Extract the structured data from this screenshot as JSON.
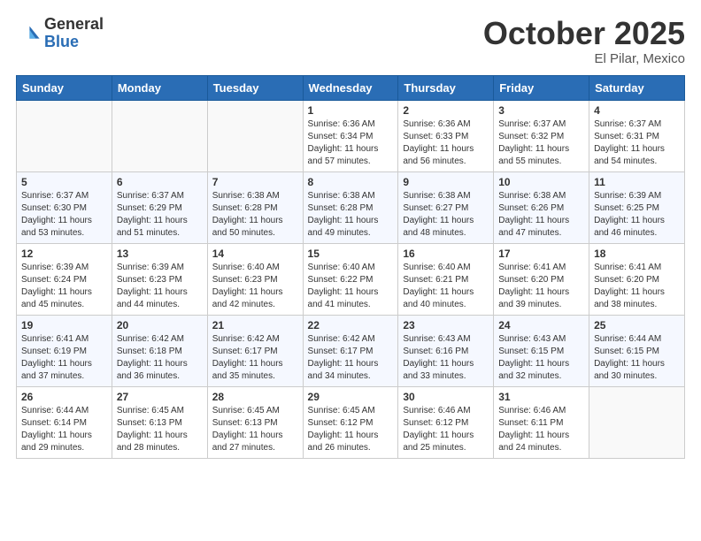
{
  "header": {
    "logo_general": "General",
    "logo_blue": "Blue",
    "month": "October 2025",
    "location": "El Pilar, Mexico"
  },
  "days_of_week": [
    "Sunday",
    "Monday",
    "Tuesday",
    "Wednesday",
    "Thursday",
    "Friday",
    "Saturday"
  ],
  "weeks": [
    [
      {
        "day": "",
        "info": ""
      },
      {
        "day": "",
        "info": ""
      },
      {
        "day": "",
        "info": ""
      },
      {
        "day": "1",
        "info": "Sunrise: 6:36 AM\nSunset: 6:34 PM\nDaylight: 11 hours\nand 57 minutes."
      },
      {
        "day": "2",
        "info": "Sunrise: 6:36 AM\nSunset: 6:33 PM\nDaylight: 11 hours\nand 56 minutes."
      },
      {
        "day": "3",
        "info": "Sunrise: 6:37 AM\nSunset: 6:32 PM\nDaylight: 11 hours\nand 55 minutes."
      },
      {
        "day": "4",
        "info": "Sunrise: 6:37 AM\nSunset: 6:31 PM\nDaylight: 11 hours\nand 54 minutes."
      }
    ],
    [
      {
        "day": "5",
        "info": "Sunrise: 6:37 AM\nSunset: 6:30 PM\nDaylight: 11 hours\nand 53 minutes."
      },
      {
        "day": "6",
        "info": "Sunrise: 6:37 AM\nSunset: 6:29 PM\nDaylight: 11 hours\nand 51 minutes."
      },
      {
        "day": "7",
        "info": "Sunrise: 6:38 AM\nSunset: 6:28 PM\nDaylight: 11 hours\nand 50 minutes."
      },
      {
        "day": "8",
        "info": "Sunrise: 6:38 AM\nSunset: 6:28 PM\nDaylight: 11 hours\nand 49 minutes."
      },
      {
        "day": "9",
        "info": "Sunrise: 6:38 AM\nSunset: 6:27 PM\nDaylight: 11 hours\nand 48 minutes."
      },
      {
        "day": "10",
        "info": "Sunrise: 6:38 AM\nSunset: 6:26 PM\nDaylight: 11 hours\nand 47 minutes."
      },
      {
        "day": "11",
        "info": "Sunrise: 6:39 AM\nSunset: 6:25 PM\nDaylight: 11 hours\nand 46 minutes."
      }
    ],
    [
      {
        "day": "12",
        "info": "Sunrise: 6:39 AM\nSunset: 6:24 PM\nDaylight: 11 hours\nand 45 minutes."
      },
      {
        "day": "13",
        "info": "Sunrise: 6:39 AM\nSunset: 6:23 PM\nDaylight: 11 hours\nand 44 minutes."
      },
      {
        "day": "14",
        "info": "Sunrise: 6:40 AM\nSunset: 6:23 PM\nDaylight: 11 hours\nand 42 minutes."
      },
      {
        "day": "15",
        "info": "Sunrise: 6:40 AM\nSunset: 6:22 PM\nDaylight: 11 hours\nand 41 minutes."
      },
      {
        "day": "16",
        "info": "Sunrise: 6:40 AM\nSunset: 6:21 PM\nDaylight: 11 hours\nand 40 minutes."
      },
      {
        "day": "17",
        "info": "Sunrise: 6:41 AM\nSunset: 6:20 PM\nDaylight: 11 hours\nand 39 minutes."
      },
      {
        "day": "18",
        "info": "Sunrise: 6:41 AM\nSunset: 6:20 PM\nDaylight: 11 hours\nand 38 minutes."
      }
    ],
    [
      {
        "day": "19",
        "info": "Sunrise: 6:41 AM\nSunset: 6:19 PM\nDaylight: 11 hours\nand 37 minutes."
      },
      {
        "day": "20",
        "info": "Sunrise: 6:42 AM\nSunset: 6:18 PM\nDaylight: 11 hours\nand 36 minutes."
      },
      {
        "day": "21",
        "info": "Sunrise: 6:42 AM\nSunset: 6:17 PM\nDaylight: 11 hours\nand 35 minutes."
      },
      {
        "day": "22",
        "info": "Sunrise: 6:42 AM\nSunset: 6:17 PM\nDaylight: 11 hours\nand 34 minutes."
      },
      {
        "day": "23",
        "info": "Sunrise: 6:43 AM\nSunset: 6:16 PM\nDaylight: 11 hours\nand 33 minutes."
      },
      {
        "day": "24",
        "info": "Sunrise: 6:43 AM\nSunset: 6:15 PM\nDaylight: 11 hours\nand 32 minutes."
      },
      {
        "day": "25",
        "info": "Sunrise: 6:44 AM\nSunset: 6:15 PM\nDaylight: 11 hours\nand 30 minutes."
      }
    ],
    [
      {
        "day": "26",
        "info": "Sunrise: 6:44 AM\nSunset: 6:14 PM\nDaylight: 11 hours\nand 29 minutes."
      },
      {
        "day": "27",
        "info": "Sunrise: 6:45 AM\nSunset: 6:13 PM\nDaylight: 11 hours\nand 28 minutes."
      },
      {
        "day": "28",
        "info": "Sunrise: 6:45 AM\nSunset: 6:13 PM\nDaylight: 11 hours\nand 27 minutes."
      },
      {
        "day": "29",
        "info": "Sunrise: 6:45 AM\nSunset: 6:12 PM\nDaylight: 11 hours\nand 26 minutes."
      },
      {
        "day": "30",
        "info": "Sunrise: 6:46 AM\nSunset: 6:12 PM\nDaylight: 11 hours\nand 25 minutes."
      },
      {
        "day": "31",
        "info": "Sunrise: 6:46 AM\nSunset: 6:11 PM\nDaylight: 11 hours\nand 24 minutes."
      },
      {
        "day": "",
        "info": ""
      }
    ]
  ]
}
